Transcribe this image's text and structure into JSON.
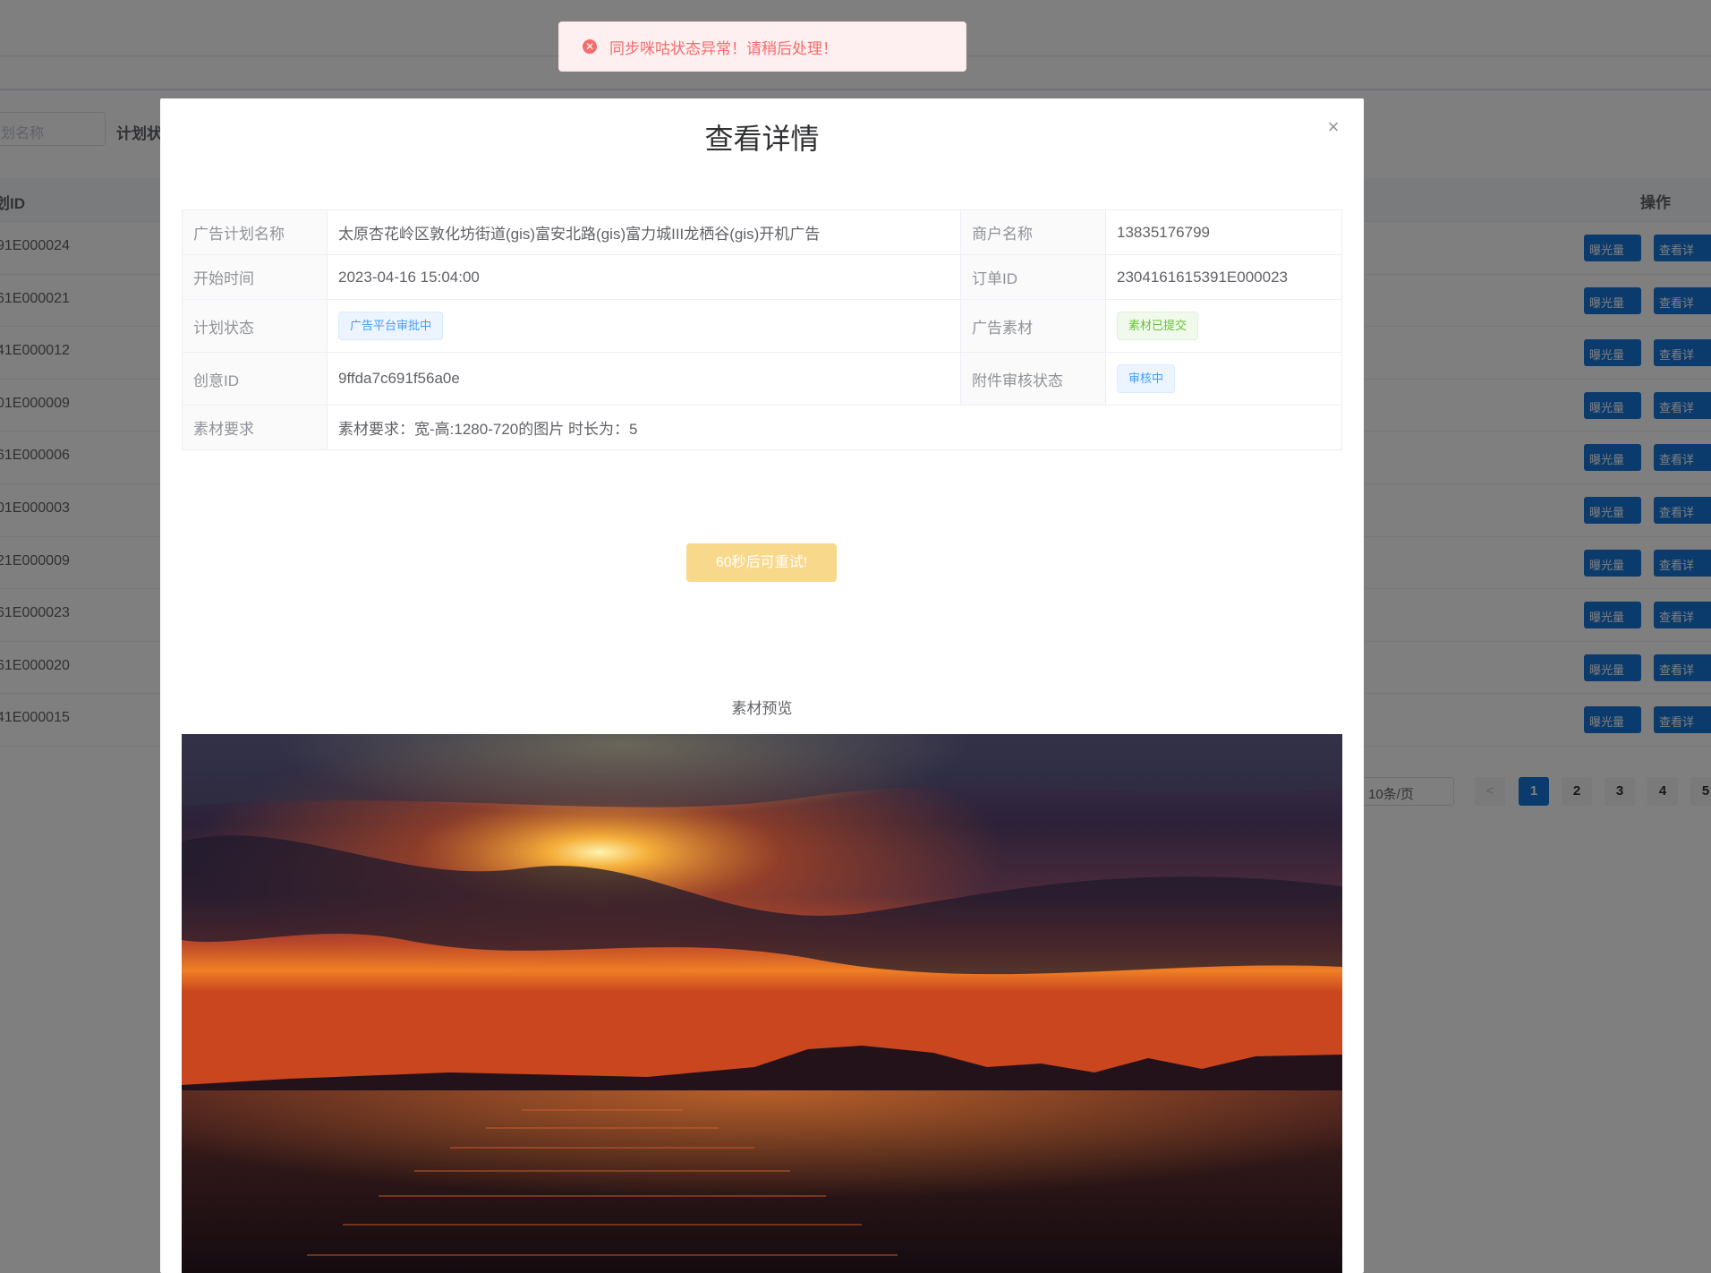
{
  "background": {
    "search_placeholder": "划名称",
    "filter_label": "计划状",
    "table": {
      "col_id_header": "划ID",
      "col_op_header": "操作",
      "rows": [
        "91E000024",
        "61E000021",
        "41E000012",
        "01E000009",
        "61E000006",
        "01E000003",
        "21E000009",
        "61E000023",
        "61E000020",
        "41E000015"
      ],
      "btn_exposure": "曝光量",
      "btn_view": "查看详"
    },
    "pagination": {
      "page_size": "10条/页",
      "prev": "<",
      "pages": [
        "1",
        "2",
        "3",
        "4",
        "5"
      ],
      "current": "1"
    }
  },
  "toast": {
    "type": "error",
    "icon": "close-circle-icon",
    "message": "同步咪咕状态异常！请稍后处理！"
  },
  "dialog": {
    "title": "查看详情",
    "close": "×",
    "fields": {
      "plan_name_label": "广告计划名称",
      "plan_name": "太原杏花岭区敦化坊街道(gis)富安北路(gis)富力城III龙栖谷(gis)开机广告",
      "merchant_label": "商户名称",
      "merchant": "13835176799",
      "start_time_label": "开始时间",
      "start_time": "2023-04-16 15:04:00",
      "order_id_label": "订单ID",
      "order_id": "2304161615391E000023",
      "plan_status_label": "计划状态",
      "plan_status": "广告平台审批中",
      "material_label": "广告素材",
      "material_status": "素材已提交",
      "creative_id_label": "创意ID",
      "creative_id": "9ffda7c691f56a0e",
      "attachment_status_label": "附件审核状态",
      "attachment_status": "审核中",
      "requirement_label": "素材要求",
      "requirement": "素材要求：宽-高:1280-720的图片 时长为：5"
    },
    "retry_button": "60秒后可重试!",
    "preview_label": "素材预览"
  },
  "colors": {
    "primary": "#1677d9",
    "error": "#f56c6c",
    "warning_disabled": "#f8d98c",
    "success": "#67c23a"
  }
}
